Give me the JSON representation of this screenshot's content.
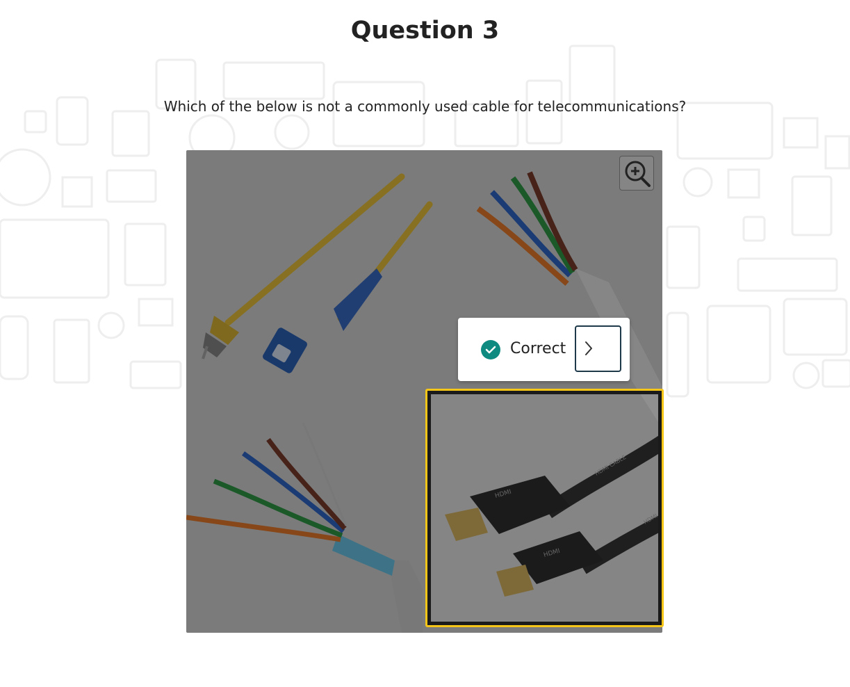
{
  "question": {
    "title": "Question 3",
    "prompt": "Which of the below is not a commonly used cable for telecommunications?"
  },
  "image": {
    "options": [
      {
        "name": "fiber-optic-cable",
        "position": "top-left"
      },
      {
        "name": "cat5-utp-cable",
        "position": "top-right"
      },
      {
        "name": "shielded-twisted-pair-cable",
        "position": "bottom-left"
      },
      {
        "name": "hdmi-cable",
        "position": "bottom-right",
        "selected": true
      }
    ],
    "printed_labels": [
      "HDMI",
      "HDMI",
      "HDMI CABLE",
      "HDMI"
    ]
  },
  "feedback": {
    "label": "Correct",
    "status": "correct",
    "icon": "checkmark-circle-icon",
    "next_icon": "chevron-right-icon"
  },
  "controls": {
    "zoom_icon": "zoom-in-icon"
  },
  "colors": {
    "accent_correct": "#0f8a80",
    "hotspot_outline": "#f5c518",
    "next_button_border": "#1e3a4a"
  }
}
